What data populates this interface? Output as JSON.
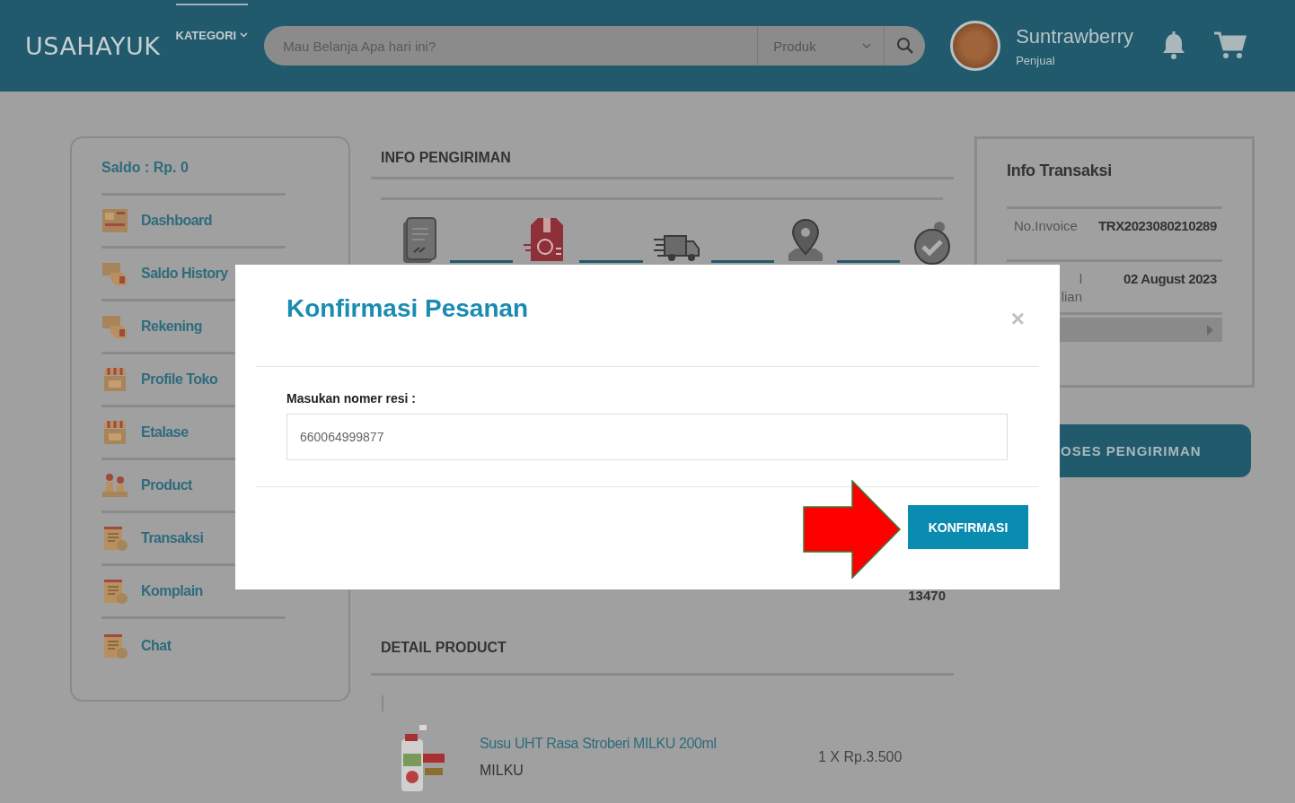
{
  "header": {
    "logo": "USAHAYUK",
    "category_menu": "KATEGORI",
    "search": {
      "placeholder": "Mau Belanja Apa hari ini?",
      "category": "Produk"
    },
    "user": {
      "name": "Suntrawberry",
      "role": "Penjual"
    }
  },
  "sidebar": {
    "balance": "Saldo : Rp. 0",
    "items": [
      {
        "label": "Dashboard"
      },
      {
        "label": "Saldo History"
      },
      {
        "label": "Rekening"
      },
      {
        "label": "Profile Toko"
      },
      {
        "label": "Etalase"
      },
      {
        "label": "Product"
      },
      {
        "label": "Transaksi"
      },
      {
        "label": "Komplain"
      },
      {
        "label": "Chat"
      }
    ]
  },
  "shipping": {
    "title": "INFO PENGIRIMAN",
    "partial_value": "13470"
  },
  "detail": {
    "title": "DETAIL PRODUCT",
    "products": [
      {
        "name": "Susu UHT Rasa Stroberi MILKU 200ml",
        "brand": "MILKU",
        "price": "1 X Rp.3.500"
      }
    ]
  },
  "transaction": {
    "title": "Info Transaksi",
    "rows": [
      {
        "label_lines": [
          "No.Invoice"
        ],
        "value": "TRX2023080210289"
      },
      {
        "label_lines": [
          "l",
          "lian"
        ],
        "value": "02 August 2023"
      }
    ],
    "action_button": "OSES PENGIRIMAN"
  },
  "modal": {
    "title": "Konfirmasi Pesanan",
    "close": "×",
    "field_label": "Masukan nomer resi :",
    "field_value": "660064999877",
    "confirm_button": "KONFIRMASI"
  }
}
